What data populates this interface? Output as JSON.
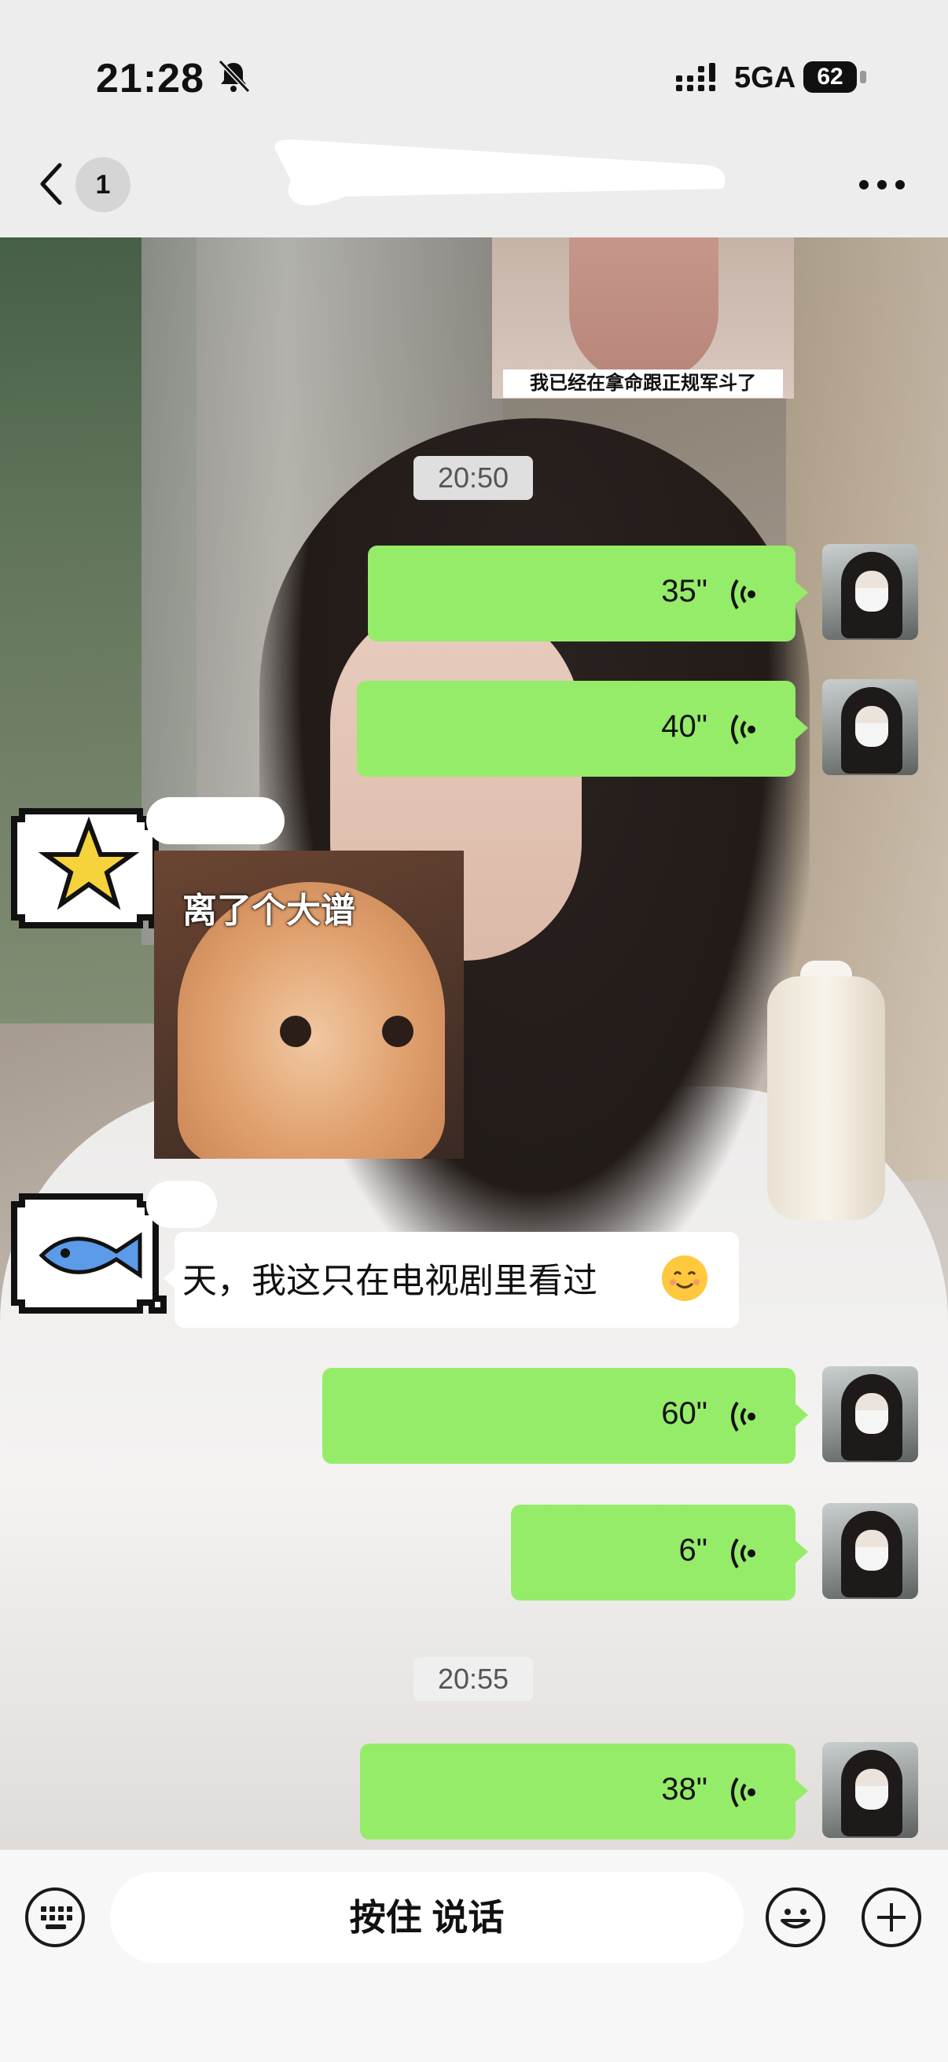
{
  "status": {
    "time": "21:28",
    "network": "5GA",
    "battery": "62"
  },
  "header": {
    "unread_count": "1"
  },
  "messages": [
    {
      "type": "sticker",
      "direction": "in",
      "caption": "我已经在拿命跟正规军斗了"
    },
    {
      "type": "timestamp",
      "text": "20:50"
    },
    {
      "type": "voice",
      "direction": "out",
      "duration": "35\""
    },
    {
      "type": "voice",
      "direction": "out",
      "duration": "40\""
    },
    {
      "type": "sticker",
      "direction": "in",
      "caption": "离了个大谱"
    },
    {
      "type": "text",
      "direction": "in",
      "text": "天，我这只在电视剧里看过"
    },
    {
      "type": "voice",
      "direction": "out",
      "duration": "60\""
    },
    {
      "type": "voice",
      "direction": "out",
      "duration": "6\""
    },
    {
      "type": "timestamp",
      "text": "20:55"
    },
    {
      "type": "voice",
      "direction": "out",
      "duration": "38\""
    }
  ],
  "input": {
    "hold_to_talk": "按住 说话"
  },
  "colors": {
    "voice_bubble": "#95ec69",
    "text_bubble": "#ffffff",
    "background": "#ededed"
  },
  "icons": {
    "star_avatar": "pixel-star",
    "fish_avatar": "pixel-fish",
    "emoji": "smiling-face"
  }
}
